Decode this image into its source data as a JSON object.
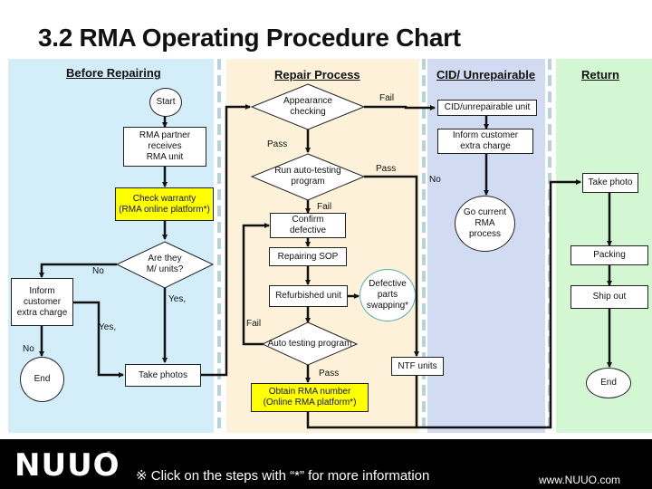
{
  "title": "3.2 RMA Operating Procedure Chart",
  "lanes": {
    "before": "Before Repairing",
    "repair": "Repair Process",
    "cid": "CID/ Unrepairable",
    "return": "Return"
  },
  "colors": {
    "before_lane": "#d3eef9",
    "repair_lane": "#fdf2d9",
    "cid_lane": "#d1dcf2",
    "return_lane": "#d2f7d2",
    "highlight_box": "#ffff00",
    "footer": "#000000"
  },
  "nodes": {
    "start": "Start",
    "rma_partner": "RMA partner\nreceives\nRMA unit",
    "check_warranty": "Check warranty\n(RMA online platform*)",
    "are_they_mw": "Are they\nM/ units?",
    "inform_customer_left": "Inform\ncustomer\nextra charge",
    "end_left": "End",
    "take_photos": "Take photos",
    "appearance_checking": "Appearance\nchecking",
    "run_auto_testing": "Run auto-testing\nprogram",
    "confirm_defective": "Confirm\ndefective",
    "repairing_sop": "Repairing SOP",
    "refurbished_unit": "Refurbished unit",
    "defective_parts": "Defective\nparts\nswapping*",
    "auto_testing_program": "Auto testing program",
    "obtain_rma_number": "Obtain RMA number\n(Online RMA platform*)",
    "ntf_units": "NTF units",
    "cid_unit": "CID/unrepairable unit",
    "inform_customer_cid": "Inform customer\nextra charge",
    "go_current_rma": "Go current\nRMA\nprocess",
    "take_photo": "Take photo",
    "packing": "Packing",
    "ship_out": "Ship out",
    "end_right": "End"
  },
  "edge_labels": {
    "no_mw": "No",
    "yes_mw": "Yes,",
    "yes_inform": "Yes,",
    "no_inform": "No",
    "fail_appearance": "Fail",
    "pass_appearance": "Pass",
    "pass_autotest": "Pass",
    "fail_autotest": "Fail",
    "no_cid": "No",
    "fail_auto2": "Fail",
    "pass_auto2": "Pass"
  },
  "footer": {
    "logo": "NUUO",
    "logo_mark": "®",
    "note": "※ Click on the steps with “*” for more information",
    "url": "www.NUUO.com"
  }
}
